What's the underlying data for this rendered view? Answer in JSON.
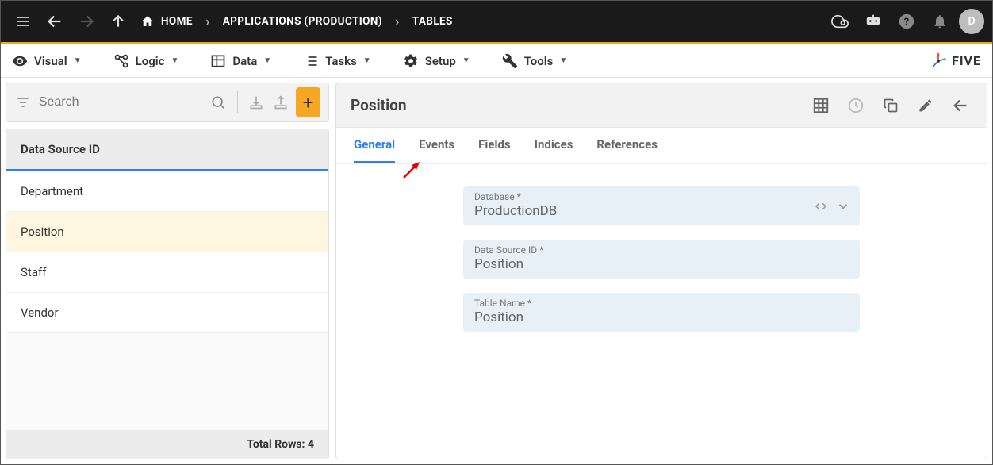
{
  "topbar": {
    "breadcrumbs": [
      {
        "label": "HOME",
        "icon": "home"
      },
      {
        "label": "APPLICATIONS (PRODUCTION)"
      },
      {
        "label": "TABLES"
      }
    ],
    "avatar_initial": "D"
  },
  "menubar": {
    "items": [
      {
        "label": "Visual",
        "icon": "eye"
      },
      {
        "label": "Logic",
        "icon": "nodes"
      },
      {
        "label": "Data",
        "icon": "table"
      },
      {
        "label": "Tasks",
        "icon": "list"
      },
      {
        "label": "Setup",
        "icon": "gear"
      },
      {
        "label": "Tools",
        "icon": "tools"
      }
    ],
    "brand": "FIVE"
  },
  "search": {
    "placeholder": "Search"
  },
  "list": {
    "header": "Data Source ID",
    "items": [
      {
        "label": "Department",
        "selected": false
      },
      {
        "label": "Position",
        "selected": true
      },
      {
        "label": "Staff",
        "selected": false
      },
      {
        "label": "Vendor",
        "selected": false
      }
    ],
    "footer": "Total Rows: 4"
  },
  "detail": {
    "title": "Position",
    "tabs": [
      {
        "label": "General",
        "active": true
      },
      {
        "label": "Events",
        "active": false
      },
      {
        "label": "Fields",
        "active": false
      },
      {
        "label": "Indices",
        "active": false
      },
      {
        "label": "References",
        "active": false
      }
    ],
    "fields": [
      {
        "label": "Database *",
        "value": "ProductionDB",
        "has_dropdown": true
      },
      {
        "label": "Data Source ID *",
        "value": "Position",
        "has_dropdown": false
      },
      {
        "label": "Table Name *",
        "value": "Position",
        "has_dropdown": false
      }
    ]
  }
}
